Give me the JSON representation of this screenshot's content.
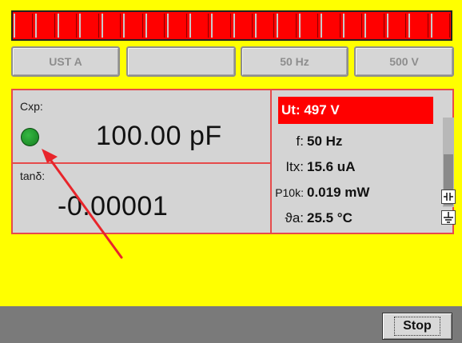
{
  "bargraph": {
    "level": 1.0,
    "segments": 20,
    "color": "#ff0000"
  },
  "top_buttons": [
    {
      "label": "UST A"
    },
    {
      "label": ""
    },
    {
      "label": "50 Hz"
    },
    {
      "label": "500 V"
    }
  ],
  "measurement": {
    "cxp_label": "Cxp:",
    "cxp_value": "100.00 pF",
    "tan_label": "tanδ:",
    "tan_value": "-0.00001",
    "status_led_color": "#1f8f2a"
  },
  "readings": {
    "ut": "Ut: 497 V",
    "f_label": "f:",
    "f_value": "50 Hz",
    "itx_label": "Itx:",
    "itx_value": "15.6 uA",
    "p10k_label": "P10k:",
    "p10k_value": "0.019 mW",
    "va_label": "ϑa:",
    "va_value": "25.5 °C"
  },
  "bottom": {
    "stop_label": "Stop"
  },
  "colors": {
    "background": "#ffff00",
    "accent_red": "#ff0000",
    "panel_border": "#e64b4b",
    "panel_bg": "#d4d4d4"
  },
  "icons": [
    "capacitor-icon",
    "ground-icon"
  ]
}
